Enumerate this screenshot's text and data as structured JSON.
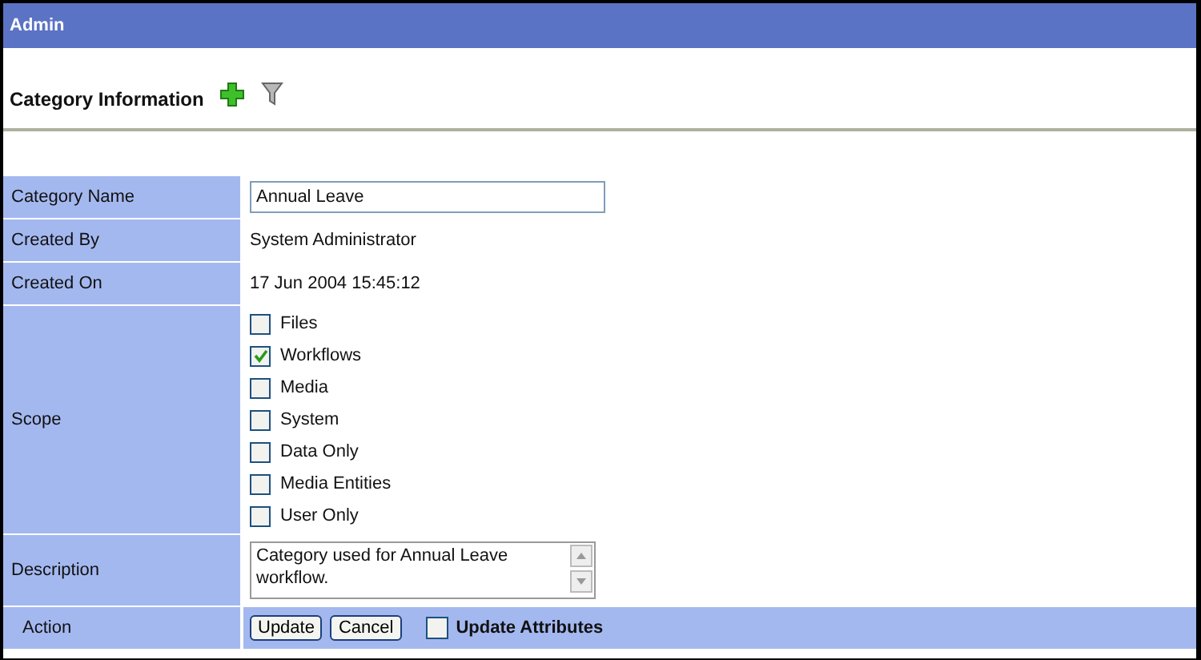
{
  "header": {
    "title": "Admin"
  },
  "section": {
    "title": "Category Information"
  },
  "rows": [
    {
      "kind": "input",
      "label": "Category Name",
      "value": "Annual Leave"
    },
    {
      "kind": "text",
      "label": "Created By",
      "value": "System Administrator"
    },
    {
      "kind": "text",
      "label": "Created On",
      "value": "17 Jun 2004 15:45:12"
    },
    {
      "kind": "checklist",
      "label": "Scope",
      "options": [
        {
          "label": "Files",
          "checked": false
        },
        {
          "label": "Workflows",
          "checked": true
        },
        {
          "label": "Media",
          "checked": false
        },
        {
          "label": "System",
          "checked": false
        },
        {
          "label": "Data Only",
          "checked": false
        },
        {
          "label": "Media Entities",
          "checked": false
        },
        {
          "label": "User Only",
          "checked": false
        }
      ]
    },
    {
      "kind": "textarea",
      "label": "Description",
      "value": "Category used for Annual Leave workflow."
    },
    {
      "kind": "actions",
      "label": "Action",
      "buttons": [
        "Update",
        "Cancel"
      ],
      "option": {
        "label": "Update Attributes",
        "checked": false
      }
    }
  ]
}
